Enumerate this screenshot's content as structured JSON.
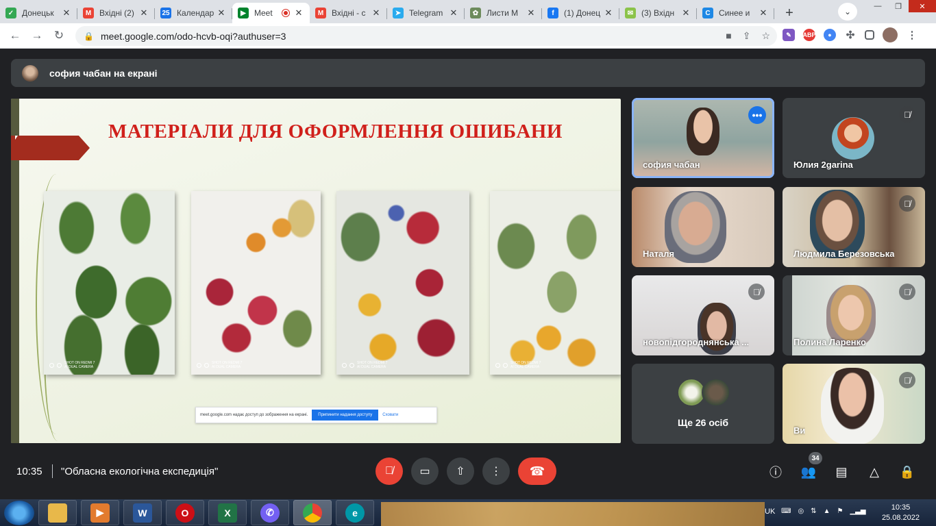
{
  "browser": {
    "tabs": [
      {
        "title": "Донецьк",
        "favicon_color": "#34a853",
        "favicon_glyph": "✓"
      },
      {
        "title": "Вхідні (2)",
        "favicon_color": "#ea4335",
        "favicon_glyph": "M"
      },
      {
        "title": "Календар",
        "favicon_color": "#1a73e8",
        "favicon_glyph": "25"
      },
      {
        "title": "Meet",
        "favicon_color": "#00832d",
        "favicon_glyph": "▶",
        "active": true
      },
      {
        "title": "Вхідні - с",
        "favicon_color": "#ea4335",
        "favicon_glyph": "M"
      },
      {
        "title": "Telegram",
        "favicon_color": "#2aabee",
        "favicon_glyph": "➤"
      },
      {
        "title": "Листи М",
        "favicon_color": "#6d8b5c",
        "favicon_glyph": "✿"
      },
      {
        "title": "(1) Донец",
        "favicon_color": "#1877f2",
        "favicon_glyph": "f"
      },
      {
        "title": "(3) Вхідн",
        "favicon_color": "#8bc34a",
        "favicon_glyph": "✉"
      },
      {
        "title": "Синее и",
        "favicon_color": "#1e88e5",
        "favicon_glyph": "C"
      }
    ],
    "url": "meet.google.com/odo-hcvb-oqi?authuser=3"
  },
  "presenter_bar": {
    "text": "софия чабан на екрані"
  },
  "slide": {
    "title": "МАТЕРІАЛИ ДЛЯ ОФОРМЛЕННЯ ОШИБАНИ",
    "photo_watermark": "SHOT ON REDMI 7\nAI DUAL CAMERA",
    "share_notice": "meet.google.com надає доступ до зображення на екрані.",
    "share_stop": "Припинити надання доступу",
    "share_hide": "Сховати"
  },
  "participants": [
    {
      "name": "софия чабан",
      "speaking": true,
      "muted": false
    },
    {
      "name": "Юлия 2garina",
      "muted": true
    },
    {
      "name": "Наталя",
      "muted": false
    },
    {
      "name": "Людмила Березовська",
      "muted": true
    },
    {
      "name": "новопідгороднянська ...",
      "muted": true
    },
    {
      "name": "Полина Ларенко",
      "muted": true
    },
    {
      "name": "Ще 26 осіб"
    },
    {
      "name": "Ви",
      "muted": true
    }
  ],
  "controls": {
    "time": "10:35",
    "meeting_name": "\"Обласна екологічна експедиція\"",
    "participants_count": "34"
  },
  "taskbar": {
    "lang": "UK",
    "time": "10:35",
    "date": "25.08.2022"
  },
  "colors": {
    "accent_blue": "#1a73e8",
    "meet_red": "#ea4335",
    "slide_title_red": "#d0201b"
  }
}
